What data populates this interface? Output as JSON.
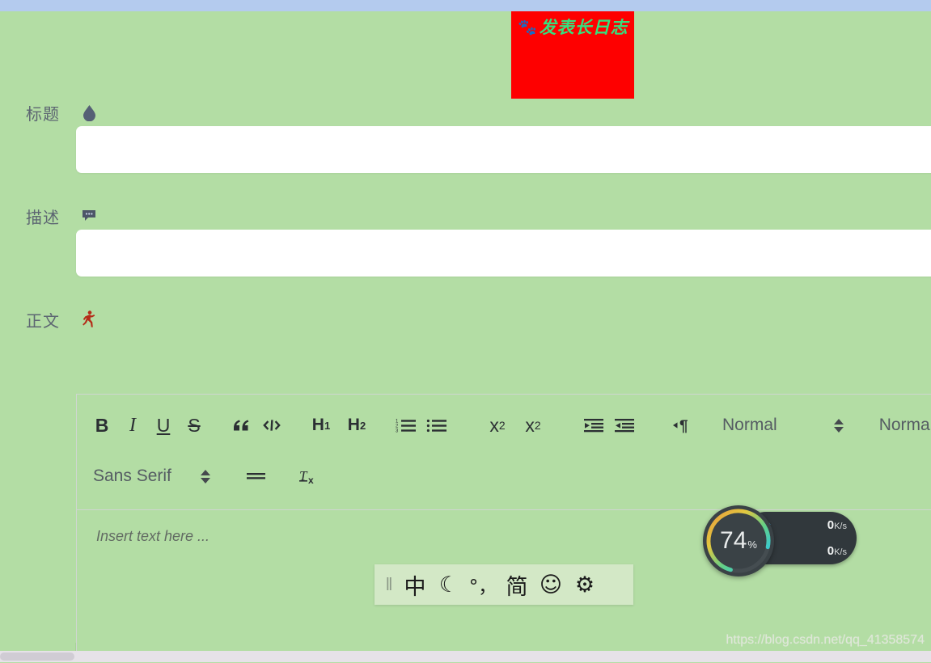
{
  "banner": {
    "icon": "paw-print-icon",
    "title": "发表长日志"
  },
  "form": {
    "fields": [
      {
        "label": "标题",
        "icon": "droplet-icon",
        "value": "",
        "placeholder": ""
      },
      {
        "label": "描述",
        "icon": "speech-bubble-icon",
        "value": "",
        "placeholder": ""
      },
      {
        "label": "正文",
        "icon": "running-person-icon"
      }
    ]
  },
  "editor": {
    "placeholder": "Insert text here ...",
    "toolbar": {
      "row1": [
        {
          "name": "bold-icon",
          "label": "B"
        },
        {
          "name": "italic-icon",
          "label": "I"
        },
        {
          "name": "underline-icon",
          "label": "U"
        },
        {
          "name": "strikethrough-icon",
          "label": "S"
        },
        {
          "name": "blockquote-icon",
          "label": "”"
        },
        {
          "name": "code-block-icon",
          "label": "</>"
        },
        {
          "name": "heading-1-icon",
          "label": "H1"
        },
        {
          "name": "heading-2-icon",
          "label": "H2"
        },
        {
          "name": "ordered-list-icon",
          "label": "1.2.3."
        },
        {
          "name": "bullet-list-icon",
          "label": "•••"
        },
        {
          "name": "subscript-icon",
          "label": "x2"
        },
        {
          "name": "superscript-icon",
          "label": "x²"
        },
        {
          "name": "outdent-icon",
          "label": "outdent"
        },
        {
          "name": "indent-icon",
          "label": "indent"
        },
        {
          "name": "text-direction-icon",
          "label": "¶"
        }
      ],
      "size_picker": {
        "value": "Normal"
      },
      "header_picker": {
        "value": "Normal"
      },
      "font_picker": {
        "value": "Sans Serif"
      },
      "row2": [
        {
          "name": "align-icon",
          "label": "align"
        },
        {
          "name": "clear-format-icon",
          "label": "Tx"
        }
      ]
    }
  },
  "ime": {
    "handle": "‖",
    "buttons": [
      {
        "name": "ime-language-mode",
        "label": "中"
      },
      {
        "name": "ime-moon-icon",
        "label": "☾"
      },
      {
        "name": "ime-punctuation-icon",
        "label": "°，"
      },
      {
        "name": "ime-simplified-icon",
        "label": "简"
      },
      {
        "name": "ime-emoji-icon",
        "label": "☺"
      },
      {
        "name": "ime-settings-icon",
        "label": "⚙"
      }
    ]
  },
  "sysmon": {
    "cpu_percent": "74",
    "percent_symbol": "%",
    "upload": {
      "arrow": "↑",
      "value": "0",
      "unit": "K/s"
    },
    "download": {
      "arrow": "↓",
      "value": "0",
      "unit": "K/s"
    }
  },
  "watermark": "https://blog.csdn.net/qq_41358574",
  "colors": {
    "background": "#b3dda4",
    "banner_bg": "#fe0000",
    "banner_text": "#35e07e",
    "top_strip": "#b4cbee",
    "input_bg": "#ffffff",
    "label_text": "#5d6672",
    "running_icon": "#b52b18",
    "gauge_bg": "#3a4246",
    "upload_arrow": "#4aa3e0",
    "download_arrow": "#54c26b"
  }
}
